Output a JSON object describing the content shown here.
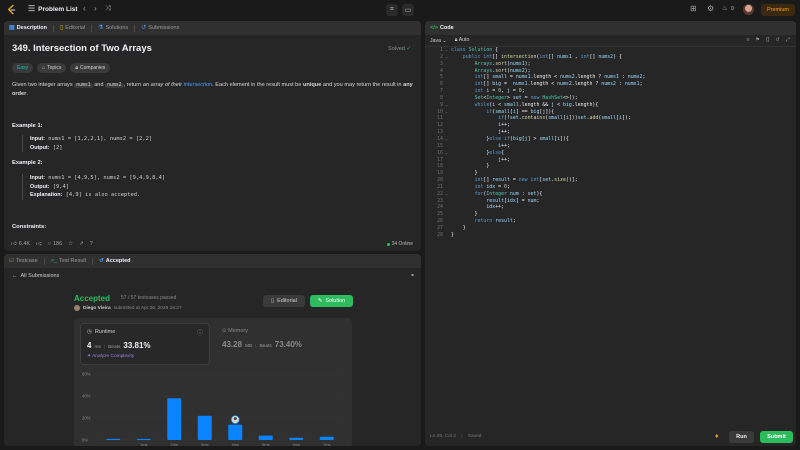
{
  "topbar": {
    "problem_list": "Problem List",
    "premium": "Premium",
    "streak_count": "0"
  },
  "description_panel": {
    "tabs": [
      "Description",
      "Editorial",
      "Solutions",
      "Submissions"
    ],
    "title": "349. Intersection of Two Arrays",
    "status": "Solved",
    "chips": [
      "Easy",
      "Topics",
      "Companies"
    ],
    "para": {
      "p1": "Given two integer arrays ",
      "c1": "nums1",
      "p2": " and ",
      "c2": "nums2",
      "p3": ", return ",
      "em1": "an array of their ",
      "link": "intersection",
      "p4": ". Each element in the result must be ",
      "b1": "unique",
      "p5": " and you may return the result in ",
      "b2": "any order",
      "p6": "."
    },
    "examples": [
      {
        "title": "Example 1:",
        "input_label": "Input:",
        "input": "nums1 = [1,2,2,1], nums2 = [2,2]",
        "output_label": "Output:",
        "output": "[2]"
      },
      {
        "title": "Example 2:",
        "input_label": "Input:",
        "input": "nums1 = [4,9,5], nums2 = [9,4,9,8,4]",
        "output_label": "Output:",
        "output": "[9,4]",
        "expl_label": "Explanation:",
        "explanation": "[4,9] is also accepted."
      }
    ],
    "constraints": "Constraints:",
    "footer": {
      "likes": "6.4K",
      "comments": "186",
      "online": "34 Online"
    }
  },
  "result_panel": {
    "tabs": [
      "Testcase",
      "Test Result",
      "Accepted"
    ],
    "back": "All Submissions",
    "status": "Accepted",
    "passed": "57 / 57 testcases passed",
    "user": "Diego Vieira",
    "submitted": "submitted at Apr 26, 2025 18:27",
    "editorial_btn": "Editorial",
    "solution_btn": "Solution",
    "runtime": {
      "label": "Runtime",
      "value": "4",
      "unit": "ms",
      "beats_label": "Beats",
      "beats": "33.81%",
      "analyze": "Analyze Complexity"
    },
    "memory": {
      "label": "Memory",
      "value": "43.28",
      "unit": "MB",
      "beats_label": "Beats",
      "beats": "73.40%"
    }
  },
  "chart_data": {
    "type": "bar",
    "categories": [
      "",
      "1ms",
      "2ms",
      "3ms",
      "4ms",
      "5ms",
      "6ms",
      "7ms"
    ],
    "values": [
      1,
      1,
      38,
      22,
      14,
      4,
      2,
      3
    ],
    "ylim": [
      0,
      60
    ],
    "yticks": [
      "60%",
      "40%",
      "20%",
      "0%"
    ],
    "highlight_index": 4,
    "bar_color": "#0a84ff",
    "grid": true
  },
  "code_panel": {
    "title": "Code",
    "language": "Java",
    "mode": "Auto",
    "status_left": "Ln 28, Col 2",
    "status_saved": "Saved",
    "run": "Run",
    "submit": "Submit"
  },
  "code_lines": [
    [
      [
        "kw",
        "class "
      ],
      [
        "ty",
        "Solution "
      ],
      [
        "",
        "{"
      ]
    ],
    [
      [
        "",
        "    "
      ],
      [
        "kw",
        "public int"
      ],
      [
        "",
        "[] "
      ],
      [
        "fn",
        "intersection"
      ],
      [
        "",
        "("
      ],
      [
        "kw",
        "int"
      ],
      [
        "",
        "[] "
      ],
      [
        "vr",
        "nums1"
      ],
      [
        "",
        " , "
      ],
      [
        "kw",
        "int"
      ],
      [
        "",
        "[] "
      ],
      [
        "vr",
        "nums2"
      ],
      [
        "",
        ") {"
      ]
    ],
    [
      [
        "",
        "        "
      ],
      [
        "ty",
        "Arrays"
      ],
      [
        "",
        "."
      ],
      [
        "fn",
        "sort"
      ],
      [
        "",
        "("
      ],
      [
        "vr",
        "nums1"
      ],
      [
        "",
        ");"
      ]
    ],
    [
      [
        "",
        "        "
      ],
      [
        "ty",
        "Arrays"
      ],
      [
        "",
        "."
      ],
      [
        "fn",
        "sort"
      ],
      [
        "",
        "("
      ],
      [
        "vr",
        "nums2"
      ],
      [
        "",
        ");"
      ]
    ],
    [
      [
        "",
        "        "
      ],
      [
        "kw",
        "int"
      ],
      [
        "",
        "[] "
      ],
      [
        "vr",
        "small"
      ],
      [
        "",
        " = "
      ],
      [
        "vr",
        "nums1"
      ],
      [
        "",
        ".length < "
      ],
      [
        "vr",
        "nums2"
      ],
      [
        "",
        ".length ? "
      ],
      [
        "vr",
        "nums1"
      ],
      [
        "",
        " : "
      ],
      [
        "vr",
        "nums2"
      ],
      [
        "",
        ";"
      ]
    ],
    [
      [
        "",
        "        "
      ],
      [
        "kw",
        "int"
      ],
      [
        "",
        "[] "
      ],
      [
        "vr",
        "big"
      ],
      [
        "",
        " =  "
      ],
      [
        "vr",
        "nums1"
      ],
      [
        "",
        ".length < "
      ],
      [
        "vr",
        "nums2"
      ],
      [
        "",
        ".length ? "
      ],
      [
        "vr",
        "nums2"
      ],
      [
        "",
        " : "
      ],
      [
        "vr",
        "nums1"
      ],
      [
        "",
        ";"
      ]
    ],
    [
      [
        "",
        "        "
      ],
      [
        "kw",
        "int "
      ],
      [
        "vr",
        "i"
      ],
      [
        "",
        " = "
      ],
      [
        "nm",
        "0"
      ],
      [
        "",
        ", "
      ],
      [
        "vr",
        "j"
      ],
      [
        "",
        " = "
      ],
      [
        "nm",
        "0"
      ],
      [
        "",
        ";"
      ]
    ],
    [
      [
        "",
        "        "
      ],
      [
        "ty",
        "Set"
      ],
      [
        "",
        "<"
      ],
      [
        "ty",
        "Integer"
      ],
      [
        "",
        "> "
      ],
      [
        "vr",
        "set"
      ],
      [
        "",
        " = "
      ],
      [
        "kw",
        "new "
      ],
      [
        "ty",
        "HashSet"
      ],
      [
        "",
        "<>();"
      ]
    ],
    [
      [
        "",
        "        "
      ],
      [
        "kw",
        "while"
      ],
      [
        "",
        "("
      ],
      [
        "vr",
        "i"
      ],
      [
        "",
        " < "
      ],
      [
        "vr",
        "small"
      ],
      [
        "",
        ".length && "
      ],
      [
        "vr",
        "j"
      ],
      [
        "",
        " < "
      ],
      [
        "vr",
        "big"
      ],
      [
        "",
        ".length){"
      ]
    ],
    [
      [
        "",
        "            "
      ],
      [
        "kw",
        "if"
      ],
      [
        "",
        "("
      ],
      [
        "vr",
        "small"
      ],
      [
        "",
        "["
      ],
      [
        "vr",
        "i"
      ],
      [
        "",
        "] == "
      ],
      [
        "vr",
        "big"
      ],
      [
        "",
        "["
      ],
      [
        "vr",
        "j"
      ],
      [
        "",
        "]){"
      ]
    ],
    [
      [
        "",
        "                "
      ],
      [
        "kw",
        "if"
      ],
      [
        "",
        "(!"
      ],
      [
        "vr",
        "set"
      ],
      [
        "",
        "."
      ],
      [
        "fn",
        "contains"
      ],
      [
        "",
        "("
      ],
      [
        "vr",
        "small"
      ],
      [
        "",
        "["
      ],
      [
        "vr",
        "i"
      ],
      [
        "",
        "]))"
      ],
      [
        "vr",
        "set"
      ],
      [
        "",
        "."
      ],
      [
        "fn",
        "add"
      ],
      [
        "",
        "("
      ],
      [
        "vr",
        "small"
      ],
      [
        "",
        "["
      ],
      [
        "vr",
        "i"
      ],
      [
        "",
        "]);"
      ]
    ],
    [
      [
        "",
        "                "
      ],
      [
        "vr",
        "i"
      ],
      [
        "",
        "++;"
      ]
    ],
    [
      [
        "",
        "                "
      ],
      [
        "vr",
        "j"
      ],
      [
        "",
        "++;"
      ]
    ],
    [
      [
        "",
        "            }"
      ],
      [
        "kw",
        "else if"
      ],
      [
        "",
        "("
      ],
      [
        "vr",
        "big"
      ],
      [
        "",
        "["
      ],
      [
        "vr",
        "j"
      ],
      [
        "",
        "] > "
      ],
      [
        "vr",
        "small"
      ],
      [
        "",
        "["
      ],
      [
        "vr",
        "i"
      ],
      [
        "",
        "]){"
      ]
    ],
    [
      [
        "",
        "                "
      ],
      [
        "vr",
        "i"
      ],
      [
        "",
        "++;"
      ]
    ],
    [
      [
        "",
        "            }"
      ],
      [
        "kw",
        "else"
      ],
      [
        "",
        "{"
      ]
    ],
    [
      [
        "",
        "                "
      ],
      [
        "vr",
        "j"
      ],
      [
        "",
        "++;"
      ]
    ],
    [
      [
        "",
        "            }"
      ]
    ],
    [
      [
        "",
        "        }"
      ]
    ],
    [
      [
        "",
        "        "
      ],
      [
        "kw",
        "int"
      ],
      [
        "",
        "[] "
      ],
      [
        "vr",
        "result"
      ],
      [
        "",
        " = "
      ],
      [
        "kw",
        "new int"
      ],
      [
        "",
        "["
      ],
      [
        "vr",
        "set"
      ],
      [
        "",
        "."
      ],
      [
        "fn",
        "size"
      ],
      [
        "",
        "()];"
      ]
    ],
    [
      [
        "",
        "        "
      ],
      [
        "kw",
        "int "
      ],
      [
        "vr",
        "idx"
      ],
      [
        "",
        " = "
      ],
      [
        "nm",
        "0"
      ],
      [
        "",
        ";"
      ]
    ],
    [
      [
        "",
        "        "
      ],
      [
        "kw",
        "for"
      ],
      [
        "",
        "("
      ],
      [
        "ty",
        "Integer "
      ],
      [
        "vr",
        "num"
      ],
      [
        "",
        " : "
      ],
      [
        "vr",
        "set"
      ],
      [
        "",
        "){"
      ]
    ],
    [
      [
        "",
        "            "
      ],
      [
        "vr",
        "result"
      ],
      [
        "",
        "["
      ],
      [
        "vr",
        "idx"
      ],
      [
        "",
        "] = "
      ],
      [
        "vr",
        "num"
      ],
      [
        "",
        ";"
      ]
    ],
    [
      [
        "",
        "            "
      ],
      [
        "vr",
        "idx"
      ],
      [
        "",
        "++;"
      ]
    ],
    [
      [
        "",
        "        }"
      ]
    ],
    [
      [
        "",
        "        "
      ],
      [
        "kw",
        "return "
      ],
      [
        "vr",
        "result"
      ],
      [
        "",
        ";"
      ]
    ],
    [
      [
        "",
        "    }"
      ]
    ],
    [
      [
        "",
        "}"
      ]
    ]
  ]
}
